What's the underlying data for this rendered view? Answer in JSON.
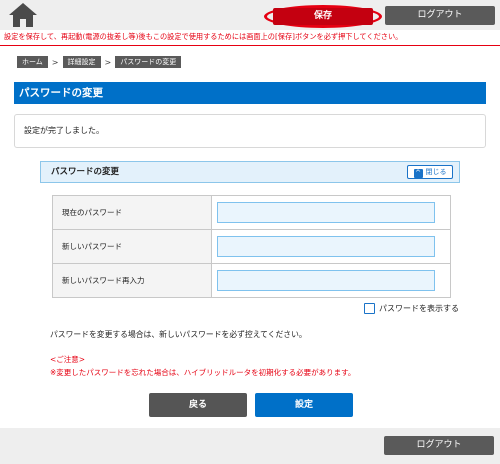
{
  "header": {
    "home_icon": "home-icon",
    "save_label": "保存",
    "logout_label": "ログアウト",
    "warning": "設定を保存して、再起動(電源の抜差し等)後もこの設定で使用するためには画面上の[保存]ボタンを必ず押下してください。"
  },
  "breadcrumb": [
    "ホーム",
    "詳細設定",
    "パスワードの変更"
  ],
  "page_title": "パスワードの変更",
  "message": "設定が完了しました。",
  "panel": {
    "title": "パスワードの変更",
    "close_label": "閉じる",
    "fields": [
      {
        "label": "現在のパスワード",
        "value": ""
      },
      {
        "label": "新しいパスワード",
        "value": ""
      },
      {
        "label": "新しいパスワード再入力",
        "value": ""
      }
    ]
  },
  "show_password": {
    "label": "パスワードを表示する",
    "checked": false
  },
  "info": "パスワードを変更する場合は、新しいパスワードを必ず控えてください。",
  "caution": {
    "title": "<ご注意>",
    "text": "※変更したパスワードを忘れた場合は、ハイブリッドルータを初期化する必要があります。"
  },
  "actions": {
    "back_label": "戻る",
    "submit_label": "設定"
  },
  "footer": {
    "logout_label": "ログアウト"
  },
  "colors": {
    "accent_blue": "#0070c8",
    "save_red": "#c40010",
    "warning_red": "#e60012",
    "dark_button": "#5a5a5a"
  }
}
